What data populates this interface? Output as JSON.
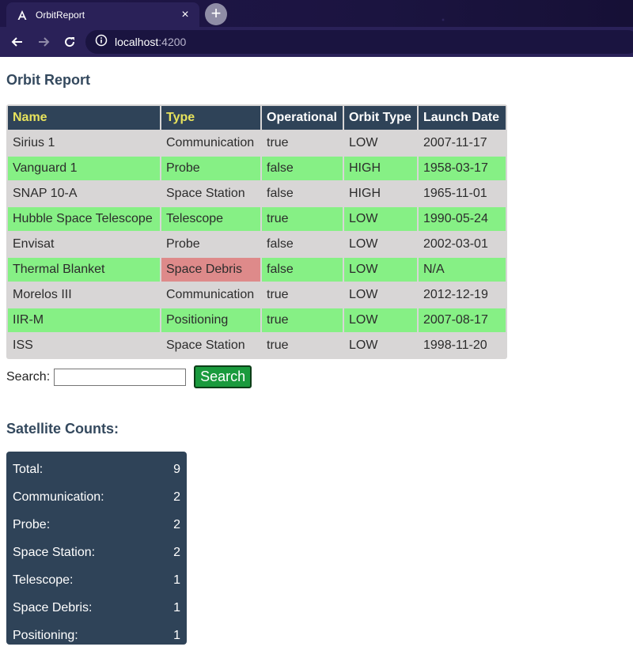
{
  "browser": {
    "tab_title": "OrbitReport",
    "close_glyph": "×",
    "newtab_glyph": "+",
    "url_host": "localhost",
    "url_port": ":4200"
  },
  "page": {
    "title": "Orbit Report"
  },
  "table": {
    "headers": [
      "Name",
      "Type",
      "Operational",
      "Orbit Type",
      "Launch Date"
    ],
    "rows": [
      [
        "Sirius 1",
        "Communication",
        "true",
        "LOW",
        "2007-11-17"
      ],
      [
        "Vanguard 1",
        "Probe",
        "false",
        "HIGH",
        "1958-03-17"
      ],
      [
        "SNAP 10-A",
        "Space Station",
        "false",
        "HIGH",
        "1965-11-01"
      ],
      [
        "Hubble Space Telescope",
        "Telescope",
        "true",
        "LOW",
        "1990-05-24"
      ],
      [
        "Envisat",
        "Probe",
        "false",
        "LOW",
        "2002-03-01"
      ],
      [
        "Thermal Blanket",
        "Space Debris",
        "false",
        "LOW",
        "N/A"
      ],
      [
        "Morelos III",
        "Communication",
        "true",
        "LOW",
        "2012-12-19"
      ],
      [
        "IIR-M",
        "Positioning",
        "true",
        "LOW",
        "2007-08-17"
      ],
      [
        "ISS",
        "Space Station",
        "true",
        "LOW",
        "1998-11-20"
      ]
    ]
  },
  "search": {
    "label": "Search:",
    "value": "",
    "button_label": "Search"
  },
  "counts": {
    "title": "Satellite Counts:",
    "items": [
      {
        "label": "Total:",
        "value": "9"
      },
      {
        "label": "Communication:",
        "value": "2"
      },
      {
        "label": "Probe:",
        "value": "2"
      },
      {
        "label": "Space Station:",
        "value": "2"
      },
      {
        "label": "Telescope:",
        "value": "1"
      },
      {
        "label": "Space Debris:",
        "value": "1"
      },
      {
        "label": "Positioning:",
        "value": "1"
      }
    ]
  },
  "colors": {
    "header_bg": "#2f4358",
    "sortable_header_text": "#e8e35c",
    "row_highlight": "#86f085",
    "row_plain": "#d8d6d6",
    "debris_cell": "#de8a8a",
    "search_button": "#1a9a3d"
  },
  "icons": {
    "favicon": "angular-logo-icon",
    "back": "arrow-left-icon",
    "forward": "arrow-right-icon",
    "reload": "reload-icon",
    "site_info": "info-icon"
  }
}
